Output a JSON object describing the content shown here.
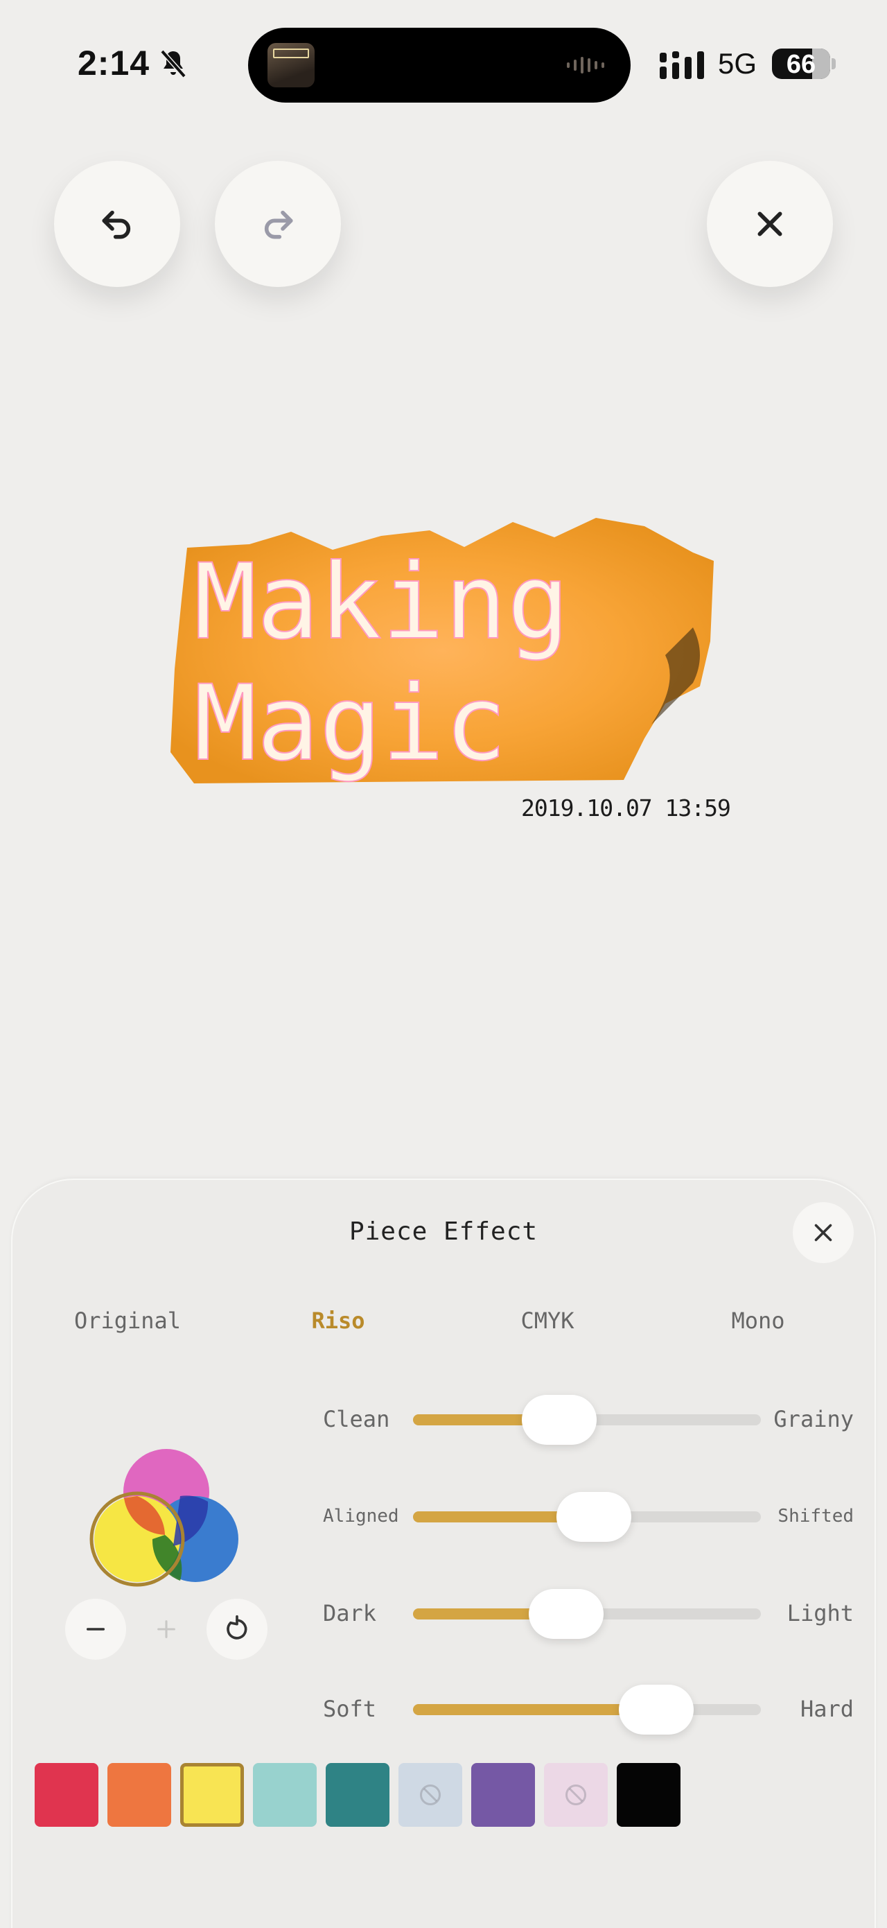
{
  "status_bar": {
    "time": "2:14",
    "network": "5G",
    "battery": "66",
    "mute_icon": "bell-slash-icon",
    "signal_icon": "cellular-signal-icon"
  },
  "toolbar": {
    "undo_icon": "undo-icon",
    "redo_icon": "redo-icon",
    "close_icon": "close-icon"
  },
  "canvas": {
    "image_text_line1": "Making",
    "image_text_line2": "Magic",
    "timestamp": "2019.10.07 13:59"
  },
  "panel": {
    "title": "Piece Effect",
    "tabs": [
      {
        "label": "Original",
        "active": false
      },
      {
        "label": "Riso",
        "active": true
      },
      {
        "label": "CMYK",
        "active": false
      },
      {
        "label": "Mono",
        "active": false
      }
    ],
    "sliders": [
      {
        "left": "Clean",
        "right": "Grainy",
        "value": 0.42
      },
      {
        "left": "Aligned",
        "right": "Shifted",
        "value": 0.52
      },
      {
        "left": "Dark",
        "right": "Light",
        "value": 0.44
      },
      {
        "left": "Soft",
        "right": "Hard",
        "value": 0.7
      }
    ],
    "ink_colors": [
      "#e067c0",
      "#3a7ccf",
      "#f6e644"
    ],
    "swatches": [
      {
        "color": "#e0344f",
        "state": "normal"
      },
      {
        "color": "#ee7640",
        "state": "normal"
      },
      {
        "color": "#f8e453",
        "state": "selected"
      },
      {
        "color": "#98d2ce",
        "state": "normal"
      },
      {
        "color": "#2f8385",
        "state": "normal"
      },
      {
        "color": "#cfd9e4",
        "state": "disabled"
      },
      {
        "color": "#7558a5",
        "state": "normal"
      },
      {
        "color": "#ecd8e6",
        "state": "disabled"
      },
      {
        "color": "#050505",
        "state": "normal"
      }
    ],
    "accent_color": "#d4a543"
  }
}
